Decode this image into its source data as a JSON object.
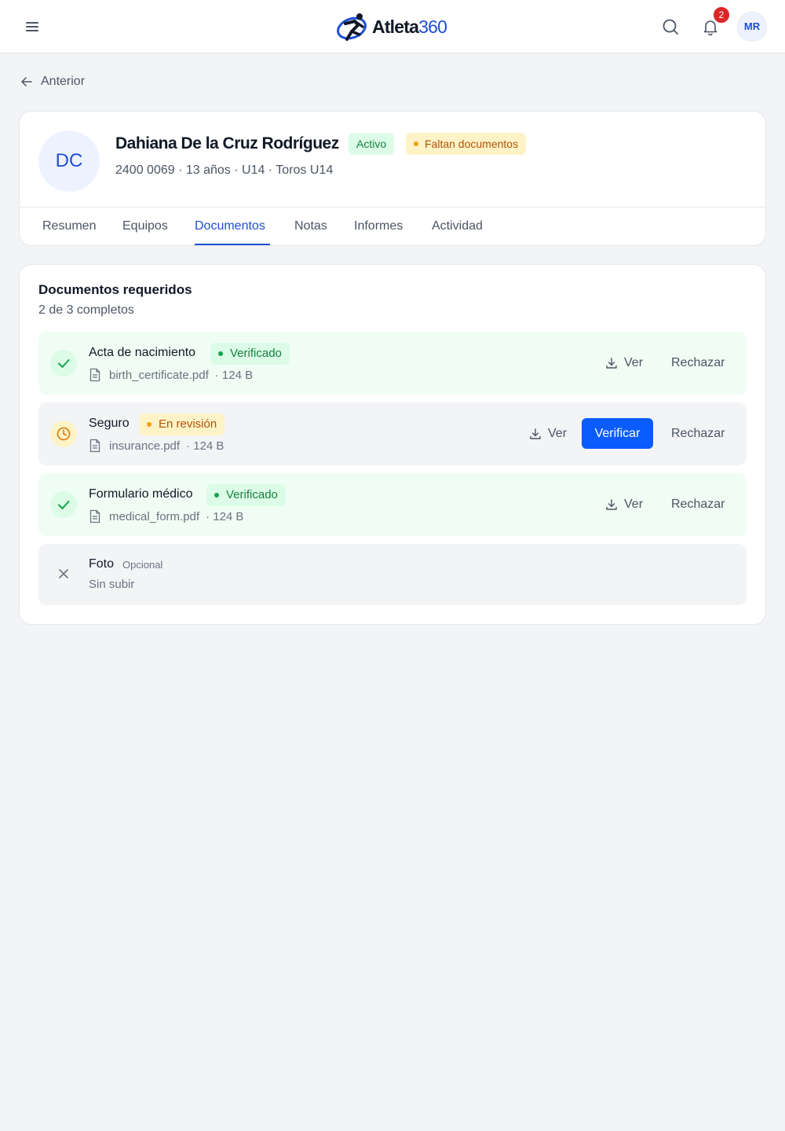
{
  "header": {
    "logo_text": "Atleta",
    "logo_number": "360",
    "notifications_count": "2",
    "user_initials": "MR"
  },
  "nav": {
    "back_label": "Anterior"
  },
  "profile": {
    "initials": "DC",
    "name": "Dahiana De la Cruz Rodríguez",
    "status_badge": "Activo",
    "warning_badge": "Faltan documentos",
    "meta": "2400 0069 · 13 años · U14 · Toros U14",
    "tabs": [
      {
        "label": "Resumen"
      },
      {
        "label": "Equipos"
      },
      {
        "label": "Documentos"
      },
      {
        "label": "Notas"
      },
      {
        "label": "Informes"
      },
      {
        "label": "Actividad"
      }
    ],
    "active_tab": "Documentos"
  },
  "documents": {
    "title": "Documentos requeridos",
    "subtitle": "2 de 3 completos",
    "items": [
      {
        "name": "Acta de nacimiento",
        "status": "Verificado",
        "file": "birth_certificate.pdf",
        "size": "· 124 B",
        "view_label": "Ver",
        "reject_label": "Rechazar"
      },
      {
        "name": "Seguro",
        "status": "En revisión",
        "file": "insurance.pdf",
        "size": "· 124 B",
        "view_label": "Ver",
        "verify_label": "Verificar",
        "reject_label": "Rechazar"
      },
      {
        "name": "Formulario médico",
        "status": "Verificado",
        "file": "medical_form.pdf",
        "size": "· 124 B",
        "view_label": "Ver",
        "reject_label": "Rechazar"
      },
      {
        "name": "Foto",
        "optional_label": "Opcional",
        "upload_status": "Sin subir"
      }
    ]
  },
  "colors": {
    "brand": "#1d4ed8",
    "primary_button": "#0b5cff",
    "success": "#15803d",
    "warning": "#b45309",
    "danger": "#dc2626"
  }
}
